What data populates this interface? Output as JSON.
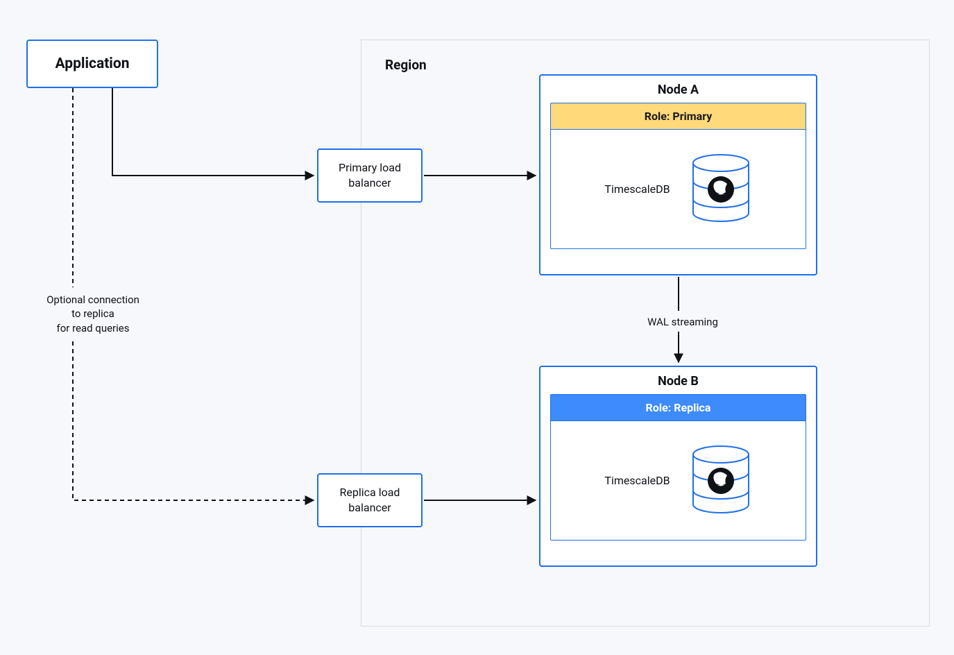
{
  "application": {
    "label": "Application"
  },
  "region": {
    "title": "Region"
  },
  "load_balancers": {
    "primary": {
      "line1": "Primary load",
      "line2": "balancer"
    },
    "replica": {
      "line1": "Replica load",
      "line2": "balancer"
    }
  },
  "nodes": {
    "a": {
      "title": "Node A",
      "role": "Role: Primary",
      "db": "TimescaleDB"
    },
    "b": {
      "title": "Node B",
      "role": "Role: Replica",
      "db": "TimescaleDB"
    }
  },
  "connections": {
    "wal": "WAL streaming",
    "optional": {
      "l1": "Optional connection",
      "l2": "to replica",
      "l3": "for read queries"
    }
  },
  "colors": {
    "border_blue": "#1f6feb",
    "primary_role": "#ffd97a",
    "replica_role": "#3d8bfd",
    "background": "#f6f8fc"
  }
}
